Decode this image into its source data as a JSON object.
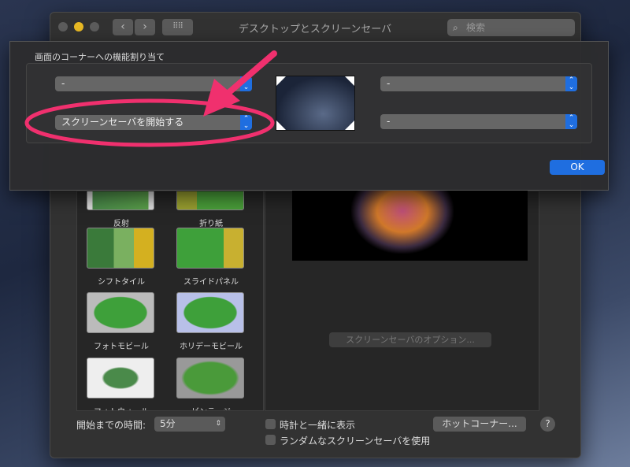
{
  "window": {
    "title": "デスクトップとスクリーンセーバ",
    "search_placeholder": "検索",
    "back": "‹",
    "forward": "›"
  },
  "sheet": {
    "label": "画面のコーナーへの機能割り当て",
    "top_left": "-",
    "bottom_left": "スクリーンセーバを開始する",
    "top_right": "-",
    "bottom_right": "-",
    "ok": "OK"
  },
  "screensavers": [
    "反射",
    "折り紙",
    "シフトタイル",
    "スライドパネル",
    "フォトモビール",
    "ホリデーモビール",
    "フォトウォール",
    "ビンテージ"
  ],
  "options_button": "スクリーンセーバのオプション...",
  "bottom": {
    "start_label": "開始までの時間:",
    "start_value": "5分",
    "show_clock": "時計と一緒に表示",
    "random": "ランダムなスクリーンセーバを使用",
    "hot_corners": "ホットコーナー...",
    "help": "?"
  },
  "colors": {
    "accent": "#1f6ee0",
    "annotation": "#f0306e"
  }
}
